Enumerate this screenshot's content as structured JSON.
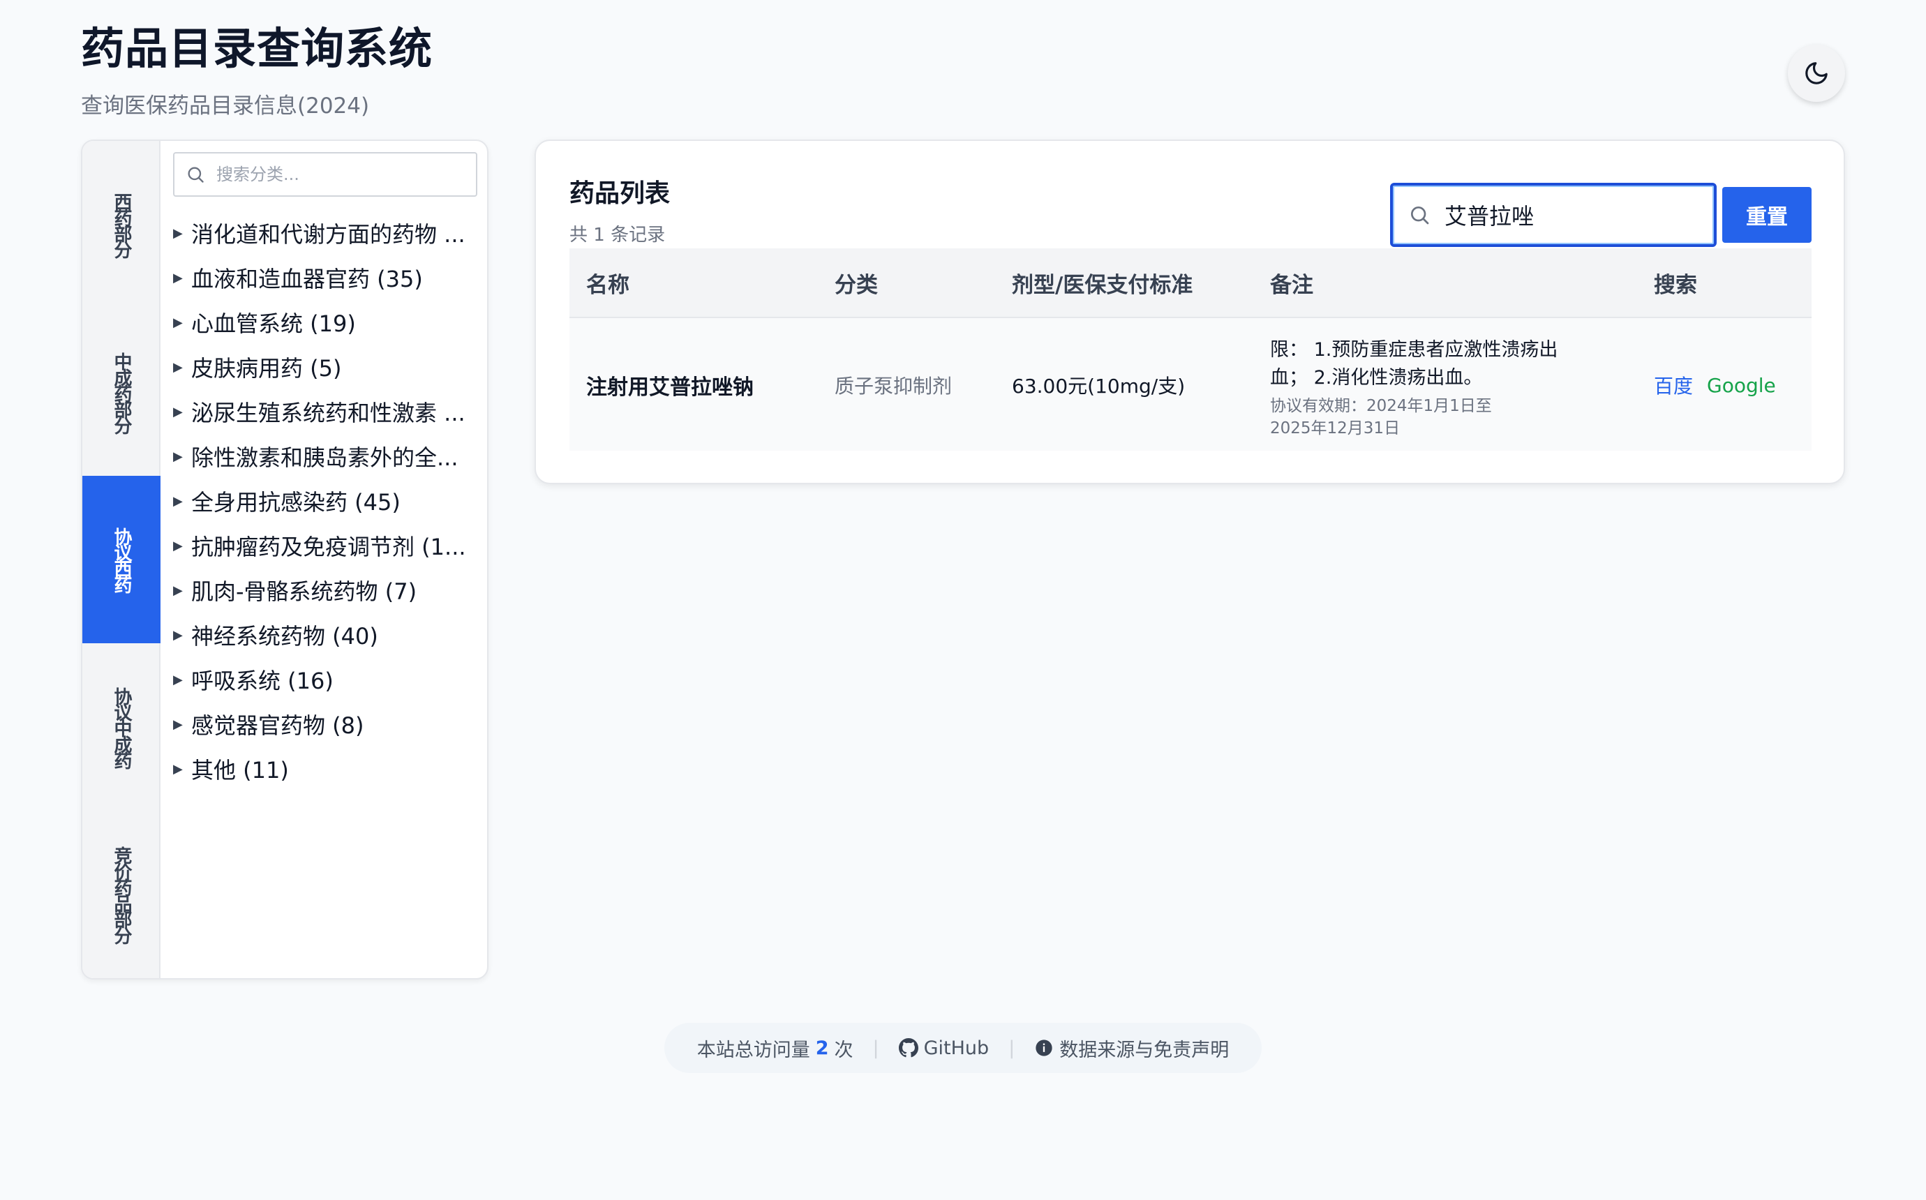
{
  "header": {
    "title": "药品目录查询系统",
    "subtitle": "查询医保药品目录信息(2024)"
  },
  "theme_toggle": {
    "icon": "moon-icon"
  },
  "sidebar": {
    "tabs": [
      {
        "label": "西药部分",
        "active": false
      },
      {
        "label": "中成药部分",
        "active": false
      },
      {
        "label": "协议西药",
        "active": true
      },
      {
        "label": "协议中成药",
        "active": false
      },
      {
        "label": "竞价药品部分",
        "active": false
      }
    ],
    "search_placeholder": "搜索分类...",
    "categories": [
      "消化道和代谢方面的药物 ...",
      "血液和造血器官药 (35)",
      "心血管系统 (19)",
      "皮肤病用药 (5)",
      "泌尿生殖系统药和性激素 ...",
      "除性激素和胰岛素外的全...",
      "全身用抗感染药 (45)",
      "抗肿瘤药及免疫调节剂 (1...",
      "肌肉-骨骼系统药物 (7)",
      "神经系统药物 (40)",
      "呼吸系统 (16)",
      "感觉器官药物 (8)",
      "其他 (11)"
    ]
  },
  "main": {
    "title": "药品列表",
    "count_text": "共 1 条记录",
    "search_value": "艾普拉唑",
    "reset_label": "重置",
    "columns": [
      "名称",
      "分类",
      "剂型/医保支付标准",
      "备注",
      "搜索"
    ],
    "rows": [
      {
        "name": "注射用艾普拉唑钠",
        "category": "质子泵抑制剂",
        "form_price": "63.00元(10mg/支)",
        "note": "限： 1.预防重症患者应激性溃疡出血； 2.消化性溃疡出血。",
        "validity": "协议有效期：2024年1月1日至2025年12月31日",
        "link_baidu": "百度",
        "link_google": "Google"
      }
    ]
  },
  "footer": {
    "visits_prefix": "本站总访问量",
    "visits_count": "2",
    "visits_suffix": "次",
    "github_label": "GitHub",
    "disclaimer_label": "数据来源与免责声明"
  },
  "colors": {
    "accent": "#2563eb",
    "google_green": "#16a34a",
    "background": "#f8fafc"
  }
}
